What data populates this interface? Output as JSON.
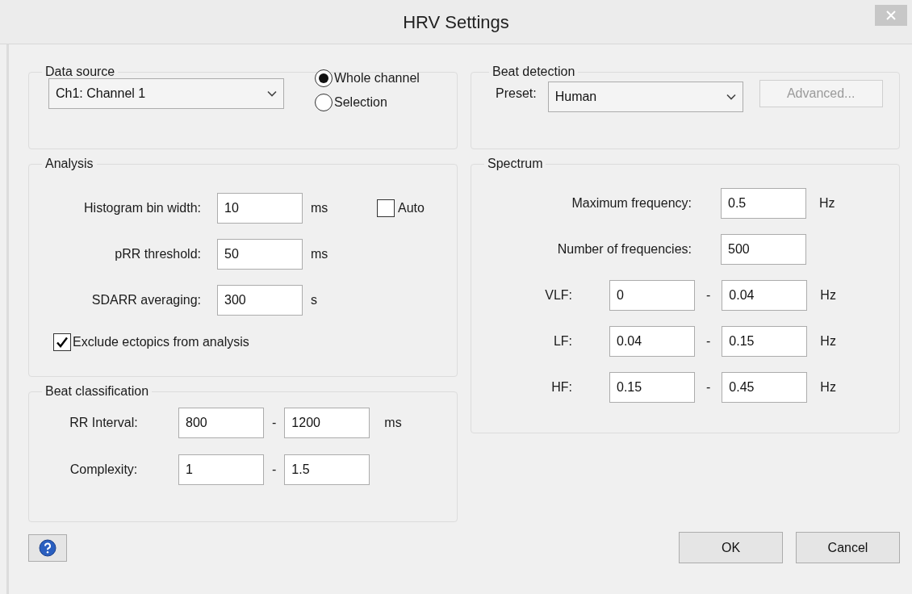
{
  "window": {
    "title": "HRV Settings"
  },
  "data_source": {
    "legend": "Data source",
    "channel": "Ch1: Channel 1",
    "options": [
      {
        "label": "Whole channel",
        "selected": true
      },
      {
        "label": "Selection",
        "selected": false
      }
    ]
  },
  "analysis": {
    "legend": "Analysis",
    "fields": [
      {
        "label": "Histogram bin width:",
        "value": "10",
        "unit": "ms"
      },
      {
        "label": "pRR threshold:",
        "value": "50",
        "unit": "ms"
      },
      {
        "label": "SDARR averaging:",
        "value": "300",
        "unit": "s"
      }
    ],
    "auto": {
      "label": "Auto",
      "checked": false
    },
    "exclude": {
      "label": "Exclude ectopics from analysis",
      "checked": true
    }
  },
  "beat_classification": {
    "legend": "Beat classification",
    "rows": [
      {
        "label": "RR Interval:",
        "from": "800",
        "separator": "-",
        "to": "1200",
        "unit": "ms"
      },
      {
        "label": "Complexity:",
        "from": "1",
        "separator": "-",
        "to": "1.5"
      }
    ]
  },
  "beat_detection": {
    "legend": "Beat detection",
    "preset_label": "Preset:",
    "preset": "Human",
    "advanced": {
      "label": "Advanced...",
      "disabled": true
    }
  },
  "spectrum": {
    "legend": "Spectrum",
    "fields": [
      {
        "label": "Maximum frequency:",
        "value": "0.5",
        "unit": "Hz"
      },
      {
        "label": "Number of frequencies:",
        "value": "500"
      }
    ],
    "bands": [
      {
        "label": "VLF:",
        "from": "0",
        "separator": "-",
        "to": "0.04",
        "unit": "Hz"
      },
      {
        "label": "LF:",
        "from": "0.04",
        "separator": "-",
        "to": "0.15",
        "unit": "Hz"
      },
      {
        "label": "HF:",
        "from": "0.15",
        "separator": "-",
        "to": "0.45",
        "unit": "Hz"
      }
    ]
  },
  "buttons": [
    {
      "label": "OK"
    },
    {
      "label": "Cancel"
    }
  ]
}
